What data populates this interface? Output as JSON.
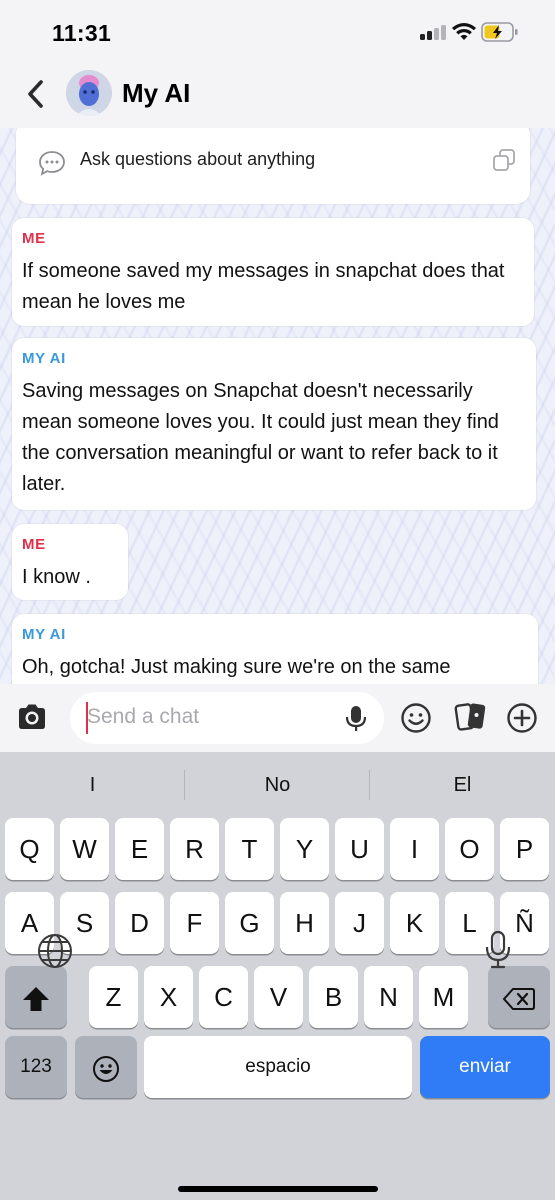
{
  "status": {
    "time": "11:31"
  },
  "header": {
    "title": "My AI"
  },
  "tip": {
    "text": "Ask questions about anything"
  },
  "messages": [
    {
      "sender": "ME",
      "text": "If someone saved  my messages in snapchat does that mean he loves me"
    },
    {
      "sender": "MY AI",
      "text": "Saving messages on Snapchat doesn't necessarily mean someone loves you. It could just mean they find the conversation meaningful or want to refer back to it later."
    },
    {
      "sender": "ME",
      "text": "I know ."
    },
    {
      "sender": "MY AI",
      "text": "Oh, gotcha! Just making sure we're on the same"
    }
  ],
  "composer": {
    "placeholder": "Send a chat"
  },
  "keyboard": {
    "suggestions": [
      "I",
      "No",
      "El"
    ],
    "row1": [
      "Q",
      "W",
      "E",
      "R",
      "T",
      "Y",
      "U",
      "I",
      "O",
      "P"
    ],
    "row2": [
      "A",
      "S",
      "D",
      "F",
      "G",
      "H",
      "J",
      "K",
      "L",
      "Ñ"
    ],
    "row3": [
      "Z",
      "X",
      "C",
      "V",
      "B",
      "N",
      "M"
    ],
    "numbers_label": "123",
    "space_label": "espacio",
    "send_label": "enviar"
  },
  "colors": {
    "me": "#e0304a",
    "ai": "#3a9ad9",
    "send_key": "#2f7cf6"
  },
  "icons": [
    "back-chevron-icon",
    "chat-bubble-icon",
    "copy-icon",
    "camera-icon",
    "microphone-icon",
    "emoji-icon",
    "sticker-icon",
    "plus-icon",
    "shift-icon",
    "backspace-icon",
    "globe-icon"
  ]
}
